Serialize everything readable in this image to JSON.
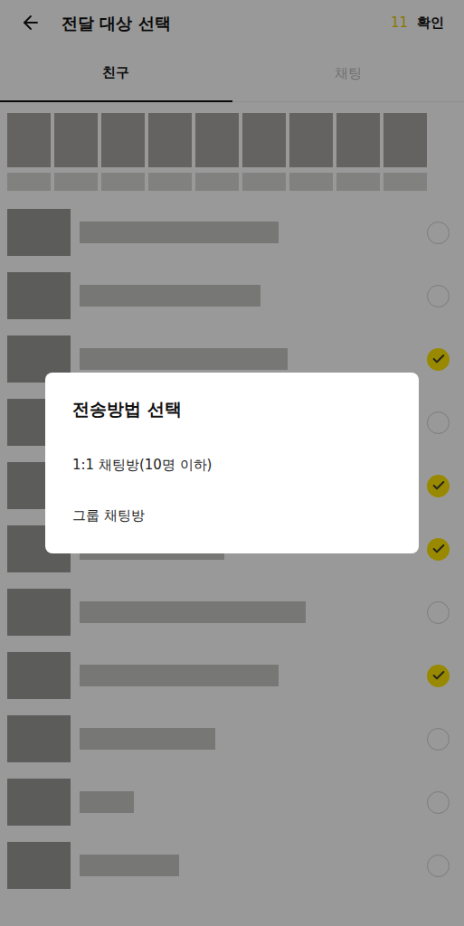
{
  "header": {
    "title": "전달 대상 선택",
    "count": "11",
    "confirm": "확인"
  },
  "tabs": [
    {
      "label": "친구",
      "selected": true
    },
    {
      "label": "채팅",
      "selected": false
    }
  ],
  "friends": [
    {
      "checked": false
    },
    {
      "checked": false
    },
    {
      "checked": true
    },
    {
      "checked": false
    },
    {
      "checked": true
    },
    {
      "checked": true
    },
    {
      "checked": false
    },
    {
      "checked": true
    },
    {
      "checked": false
    },
    {
      "checked": false
    },
    {
      "checked": false
    }
  ],
  "dialog": {
    "title": "전송방법 선택",
    "options": [
      "1:1 채팅방(10명 이하)",
      "그룹 채팅방"
    ]
  }
}
